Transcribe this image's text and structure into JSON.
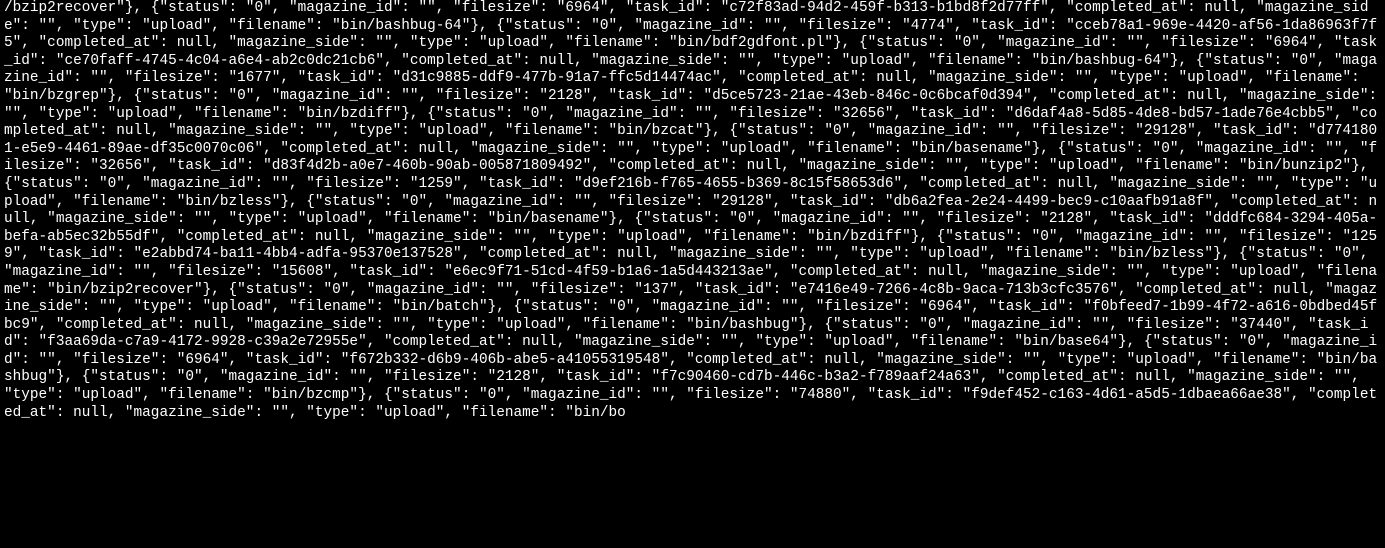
{
  "prefix": "/bzip2recover\"}, ",
  "records": [
    {
      "status": "0",
      "magazine_id": "",
      "filesize": "6964",
      "task_id": "c72f83ad-94d2-459f-b313-b1bd8f2d77ff",
      "completed_at": null,
      "magazine_side": "",
      "type": "upload",
      "filename": "bin/bashbug-64"
    },
    {
      "status": "0",
      "magazine_id": "",
      "filesize": "4774",
      "task_id": "cceb78a1-969e-4420-af56-1da86963f7f5",
      "completed_at": null,
      "magazine_side": "",
      "type": "upload",
      "filename": "bin/bdf2gdfont.pl"
    },
    {
      "status": "0",
      "magazine_id": "",
      "filesize": "6964",
      "task_id": "ce70faff-4745-4c04-a6e4-ab2c0dc21cb6",
      "completed_at": null,
      "magazine_side": "",
      "type": "upload",
      "filename": "bin/bashbug-64"
    },
    {
      "status": "0",
      "magazine_id": "",
      "filesize": "1677",
      "task_id": "d31c9885-ddf9-477b-91a7-ffc5d14474ac",
      "completed_at": null,
      "magazine_side": "",
      "type": "upload",
      "filename": "bin/bzgrep"
    },
    {
      "status": "0",
      "magazine_id": "",
      "filesize": "2128",
      "task_id": "d5ce5723-21ae-43eb-846c-0c6bcaf0d394",
      "completed_at": null,
      "magazine_side": "",
      "type": "upload",
      "filename": "bin/bzdiff"
    },
    {
      "status": "0",
      "magazine_id": "",
      "filesize": "32656",
      "task_id": "d6daf4a8-5d85-4de8-bd57-1ade76e4cbb5",
      "completed_at": null,
      "magazine_side": "",
      "type": "upload",
      "filename": "bin/bzcat"
    },
    {
      "status": "0",
      "magazine_id": "",
      "filesize": "29128",
      "task_id": "d7741801-e5e9-4461-89ae-df35c0070c06",
      "completed_at": null,
      "magazine_side": "",
      "type": "upload",
      "filename": "bin/basename"
    },
    {
      "status": "0",
      "magazine_id": "",
      "filesize": "32656",
      "task_id": "d83f4d2b-a0e7-460b-90ab-005871809492",
      "completed_at": null,
      "magazine_side": "",
      "type": "upload",
      "filename": "bin/bunzip2"
    },
    {
      "status": "0",
      "magazine_id": "",
      "filesize": "1259",
      "task_id": "d9ef216b-f765-4655-b369-8c15f58653d6",
      "completed_at": null,
      "magazine_side": "",
      "type": "upload",
      "filename": "bin/bzless"
    },
    {
      "status": "0",
      "magazine_id": "",
      "filesize": "29128",
      "task_id": "db6a2fea-2e24-4499-bec9-c10aafb91a8f",
      "completed_at": null,
      "magazine_side": "",
      "type": "upload",
      "filename": "bin/basename"
    },
    {
      "status": "0",
      "magazine_id": "",
      "filesize": "2128",
      "task_id": "dddfc684-3294-405a-befa-ab5ec32b55df",
      "completed_at": null,
      "magazine_side": "",
      "type": "upload",
      "filename": "bin/bzdiff"
    },
    {
      "status": "0",
      "magazine_id": "",
      "filesize": "1259",
      "task_id": "e2abbd74-ba11-4bb4-adfa-95370e137528",
      "completed_at": null,
      "magazine_side": "",
      "type": "upload",
      "filename": "bin/bzless"
    },
    {
      "status": "0",
      "magazine_id": "",
      "filesize": "15608",
      "task_id": "e6ec9f71-51cd-4f59-b1a6-1a5d443213ae",
      "completed_at": null,
      "magazine_side": "",
      "type": "upload",
      "filename": "bin/bzip2recover"
    },
    {
      "status": "0",
      "magazine_id": "",
      "filesize": "137",
      "task_id": "e7416e49-7266-4c8b-9aca-713b3cfc3576",
      "completed_at": null,
      "magazine_side": "",
      "type": "upload",
      "filename": "bin/batch"
    },
    {
      "status": "0",
      "magazine_id": "",
      "filesize": "6964",
      "task_id": "f0bfeed7-1b99-4f72-a616-0bdbed45fbc9",
      "completed_at": null,
      "magazine_side": "",
      "type": "upload",
      "filename": "bin/bashbug"
    },
    {
      "status": "0",
      "magazine_id": "",
      "filesize": "37440",
      "task_id": "f3aa69da-c7a9-4172-9928-c39a2e72955e",
      "completed_at": null,
      "magazine_side": "",
      "type": "upload",
      "filename": "bin/base64"
    },
    {
      "status": "0",
      "magazine_id": "",
      "filesize": "6964",
      "task_id": "f672b332-d6b9-406b-abe5-a41055319548",
      "completed_at": null,
      "magazine_side": "",
      "type": "upload",
      "filename": "bin/bashbug"
    },
    {
      "status": "0",
      "magazine_id": "",
      "filesize": "2128",
      "task_id": "f7c90460-cd7b-446c-b3a2-f789aaf24a63",
      "completed_at": null,
      "magazine_side": "",
      "type": "upload",
      "filename": "bin/bzcmp"
    }
  ],
  "suffix": ", {\"status\": \"0\", \"magazine_id\": \"\", \"filesize\": \"74880\", \"task_id\": \"f9def452-c163-4d61-a5d5-1dbaea66ae38\", \"completed_at\": null, \"magazine_side\": \"\", \"type\": \"upload\", \"filename\": \"bin/bo"
}
